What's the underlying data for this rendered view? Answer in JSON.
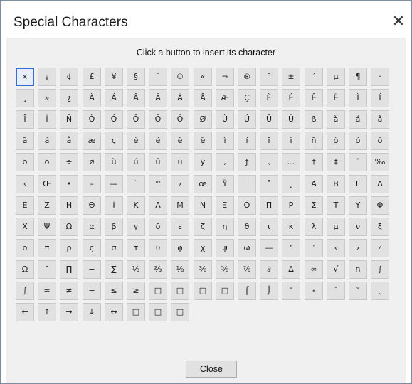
{
  "window": {
    "title": "Special Characters",
    "close_glyph": "✕"
  },
  "instruction": "Click a button to insert its character",
  "characters": [
    "×",
    "¡",
    "¢",
    "£",
    "¥",
    "§",
    "¨",
    "©",
    "«",
    "¬",
    "®",
    "°",
    "±",
    "´",
    "µ",
    "¶",
    "·",
    "¸",
    "»",
    "¿",
    "À",
    "Á",
    "Â",
    "Ã",
    "Ä",
    "Å",
    "Æ",
    "Ç",
    "È",
    "É",
    "Ê",
    "Ë",
    "Ì",
    "Í",
    "Î",
    "Ï",
    "Ñ",
    "Ò",
    "Ó",
    "Ô",
    "Õ",
    "Ö",
    "Ø",
    "Ù",
    "Ú",
    "Û",
    "Ü",
    "ß",
    "à",
    "á",
    "â",
    "ã",
    "ä",
    "å",
    "æ",
    "ç",
    "è",
    "é",
    "ê",
    "ë",
    "ì",
    "í",
    "î",
    "ï",
    "ñ",
    "ò",
    "ó",
    "ô",
    "õ",
    "ö",
    "÷",
    "ø",
    "ù",
    "ú",
    "û",
    "ü",
    "ÿ",
    "‚",
    "ƒ",
    "„",
    "…",
    "†",
    "‡",
    "ˆ",
    "‰",
    "‹",
    "Œ",
    "•",
    "–",
    "—",
    "˜",
    "™",
    "›",
    "œ",
    "Ÿ",
    "˙",
    "˚",
    "˛",
    "Α",
    "Β",
    "Γ",
    "Δ",
    "Ε",
    "Ζ",
    "Η",
    "Θ",
    "Ι",
    "Κ",
    "Λ",
    "Μ",
    "Ν",
    "Ξ",
    "Ο",
    "Π",
    "Ρ",
    "Σ",
    "Τ",
    "Υ",
    "Φ",
    "Χ",
    "Ψ",
    "Ω",
    "α",
    "β",
    "γ",
    "δ",
    "ε",
    "ζ",
    "η",
    "θ",
    "ι",
    "κ",
    "λ",
    "μ",
    "ν",
    "ξ",
    "ο",
    "π",
    "ρ",
    "ς",
    "σ",
    "τ",
    "υ",
    "φ",
    "χ",
    "ψ",
    "ω",
    "—",
    "‘",
    "’",
    "‹",
    "›",
    "⁄",
    "Ω",
    "ˉ",
    "∏",
    "−",
    "∑",
    "⅓",
    "⅔",
    "⅛",
    "⅜",
    "⅝",
    "⅞",
    "∂",
    "∆",
    "∞",
    "√",
    "∩",
    "∫",
    "∫",
    "≈",
    "≠",
    "≡",
    "≤",
    "≥",
    "□",
    "□",
    "□",
    "□",
    "⌠",
    "⌡",
    "˚",
    "˖",
    "˙",
    "˚",
    "˛",
    "←",
    "↑",
    "→",
    "↓",
    "↔",
    "□",
    "□",
    "□"
  ],
  "selected_index": 0,
  "close_button_label": "Close"
}
